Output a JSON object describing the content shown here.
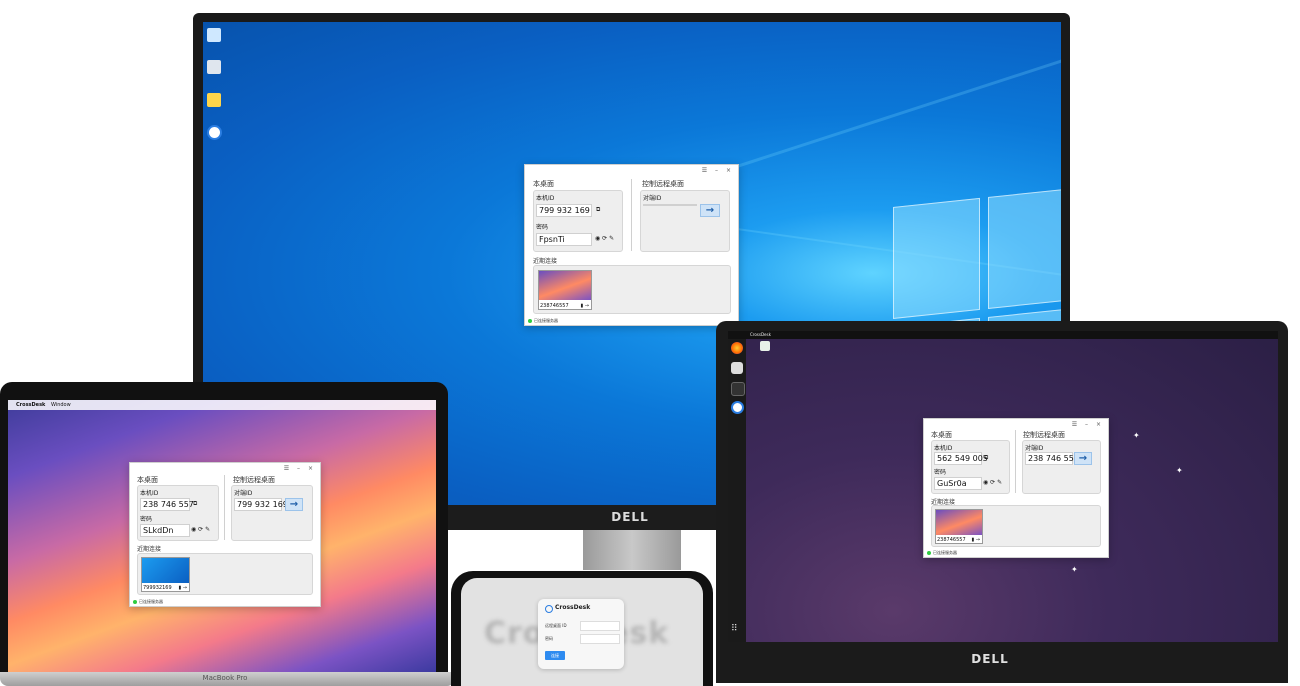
{
  "windows_monitor": {
    "brand": "DELL",
    "desktop_icons": [
      "",
      "",
      "",
      ""
    ],
    "crossdesk": {
      "local_section": "本桌面",
      "remote_section": "控制远程桌面",
      "local_id_label": "本机ID",
      "local_id": "799 932 169",
      "password_label": "密码",
      "password": "FpsnTi",
      "peer_id_label": "对端ID",
      "peer_id": "",
      "recent_label": "近期连接",
      "recent": [
        {
          "id": "238746557"
        }
      ],
      "status": "已连接服务器"
    }
  },
  "macbook": {
    "label": "MacBook Pro",
    "menubar_app": "CrossDesk",
    "menubar_menu": "Window",
    "crossdesk": {
      "local_section": "本桌面",
      "remote_section": "控制远程桌面",
      "local_id_label": "本机ID",
      "local_id": "238 746 557",
      "password_label": "密码",
      "password": "SLkdDn",
      "peer_id_label": "对端ID",
      "peer_id": "799 932 169",
      "recent_label": "近期连接",
      "recent": [
        {
          "id": "799932169"
        }
      ],
      "status": "已连接服务器"
    }
  },
  "ubuntu_laptop": {
    "brand": "DELL",
    "topbar_app": "CrossDesk",
    "crossdesk": {
      "local_section": "本桌面",
      "remote_section": "控制远程桌面",
      "local_id_label": "本机ID",
      "local_id": "562 549 005",
      "password_label": "密码",
      "password": "GuSr0a",
      "peer_id_label": "对端ID",
      "peer_id": "238 746 557",
      "recent_label": "近期连接",
      "recent": [
        {
          "id": "238746557"
        }
      ],
      "status": "已连接服务器"
    }
  },
  "phone": {
    "background_text": "CrossDesk",
    "app_title": "CrossDesk",
    "remote_id_label": "远程桌面 ID",
    "password_label": "密码",
    "connect_button": "连接"
  },
  "colors": {
    "win_blue": "#0b78d8",
    "arrow_button": "#cfe3f7",
    "status_green": "#2ecc40",
    "phone_button": "#2e8bf0"
  }
}
